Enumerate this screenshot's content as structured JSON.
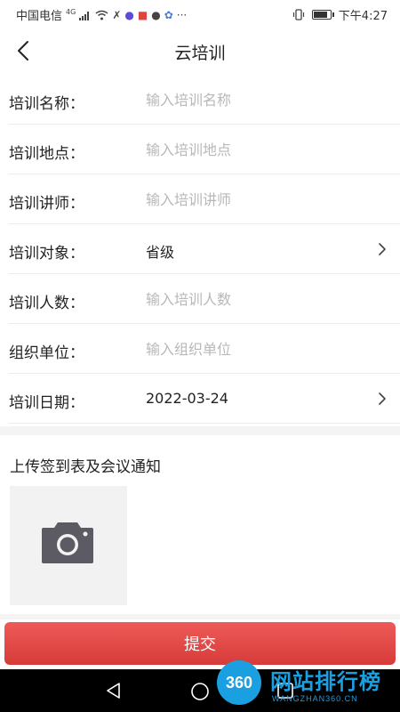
{
  "status_bar": {
    "carrier": "中国电信",
    "network": "4G",
    "time": "下午4:27",
    "battery_level": 0.9
  },
  "nav": {
    "title": "云培训",
    "back_icon": "chevron-left-icon"
  },
  "form": {
    "rows": [
      {
        "label": "培训名称：",
        "placeholder": "输入培训名称"
      },
      {
        "label": "培训地点：",
        "placeholder": "输入培训地点"
      },
      {
        "label": "培训讲师：",
        "placeholder": "输入培训讲师"
      },
      {
        "label": "培训对象：",
        "value": "省级",
        "has_arrow": true
      },
      {
        "label": "培训人数：",
        "placeholder": "输入培训人数"
      },
      {
        "label": "组织单位：",
        "placeholder": "输入组织单位"
      },
      {
        "label": "培训日期：",
        "value": "2022-03-24",
        "has_arrow": true
      }
    ]
  },
  "upload": {
    "title": "上传签到表及会议通知",
    "icon": "camera-icon"
  },
  "submit": {
    "label": "提交",
    "color": "#e04a47"
  },
  "watermark": {
    "badge": "360",
    "text": "网站排行榜",
    "subtext": "WANGZHAN360.CN"
  }
}
